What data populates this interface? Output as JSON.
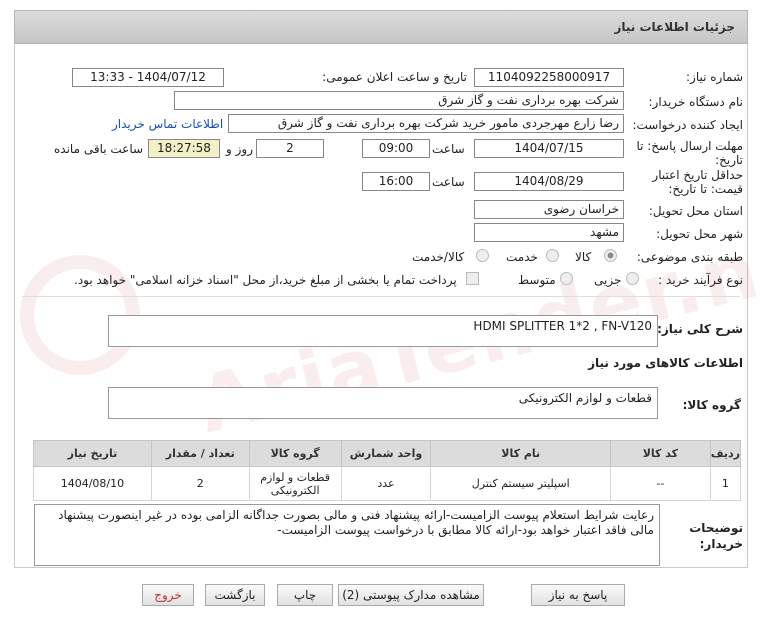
{
  "header": {
    "title": "جزئیات اطلاعات نیاز"
  },
  "fields": {
    "need_number_label": "شماره نیاز:",
    "need_number": "1104092258000917",
    "announce_label": "تاریخ و ساعت اعلان عمومی:",
    "announce_value": "1404/07/12 - 13:33",
    "buyer_org_label": "نام دستگاه خریدار:",
    "buyer_org": "شرکت بهره برداری نفت و گاز شرق",
    "creator_label": "ایجاد کننده درخواست:",
    "creator": "رضا زارع مهرجردی مامور خرید شرکت بهره برداری نفت و گاز شرق",
    "contact_link": "اطلاعات تماس خریدار",
    "deadline_label": "مهلت ارسال پاسخ: تا تاریخ:",
    "deadline_date": "1404/07/15",
    "time_label": "ساعت",
    "deadline_time": "09:00",
    "days_value": "2",
    "days_label": "روز و",
    "remaining_time": "18:27:58",
    "remaining_label": "ساعت باقی مانده",
    "validity_label": "حداقل تاریخ اعتبار قیمت: تا تاریخ:",
    "validity_date": "1404/08/29",
    "validity_time": "16:00",
    "province_label": "استان محل تحویل:",
    "province": "خراسان رضوی",
    "city_label": "شهر محل تحویل:",
    "city": "مشهد",
    "category_label": "طبقه بندی موضوعی:",
    "category_options": [
      "کالا",
      "خدمت",
      "کالا/خدمت"
    ],
    "category_selected": "کالا",
    "process_label": "نوع فرآیند خرید :",
    "process_options": [
      "جزیی",
      "متوسط"
    ],
    "process_note": "پرداخت تمام یا بخشی از مبلغ خرید،از محل \"اسناد خزانه اسلامی\" خواهد بود."
  },
  "summary": {
    "label": "شرح کلی نیاز:",
    "value": "HDMI SPLITTER 1*2 , FN-V120"
  },
  "goods": {
    "section_title": "اطلاعات کالاهای مورد نیاز",
    "group_label": "گروه کالا:",
    "group_value": "قطعات و لوازم الکترونیکی",
    "columns": [
      "ردیف",
      "کد کالا",
      "نام کالا",
      "واحد شمارش",
      "گروه کالا",
      "تعداد / مقدار",
      "تاریخ نیاز"
    ],
    "rows": [
      {
        "row": "1",
        "code": "--",
        "name": "اسپلیتر سیستم کنترل",
        "unit": "عدد",
        "group": "قطعات و لوازم الکترونیکی",
        "qty": "2",
        "date": "1404/08/10"
      }
    ]
  },
  "buyer_notes": {
    "label": "توضیحات خریدار:",
    "value": "رعایت شرایط استعلام پیوست الزامیست-ارائه پیشنهاد فنی و مالی بصورت جداگانه الزامی بوده در غیر اینصورت پیشنهاد مالی فاقد اعتبار خواهد بود-ارائه کالا مطابق با درخواست پیوست الزامیست-"
  },
  "buttons": {
    "reply": "پاسخ به نیاز",
    "attachments": "مشاهده مدارک پیوستی (2)",
    "print": "چاپ",
    "back": "بازگشت",
    "exit": "خروج"
  },
  "watermark": "AriaTender.neT",
  "colors": {
    "link": "#1a4fb0",
    "remaining_bg": "#f3efc6",
    "exit_text": "#c03030"
  }
}
